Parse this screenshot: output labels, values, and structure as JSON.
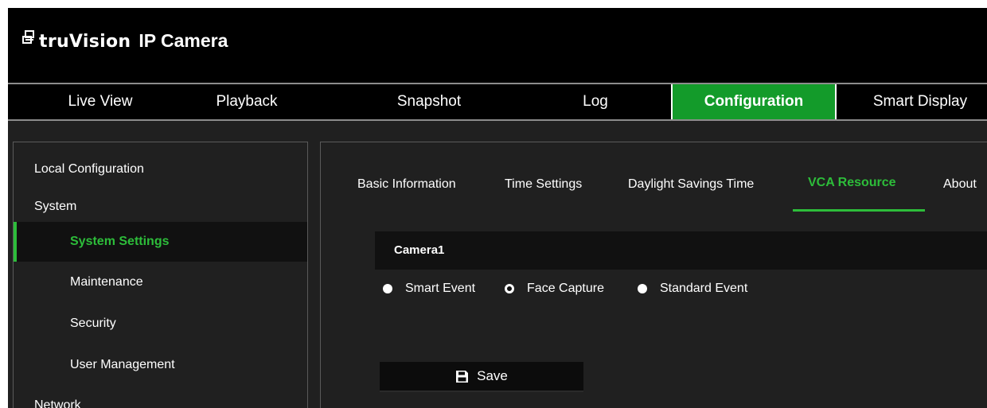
{
  "header": {
    "brand": "truVision",
    "product": "IP Camera"
  },
  "nav": {
    "items": [
      "Live View",
      "Playback",
      "Snapshot",
      "Log",
      "Configuration",
      "Smart Display"
    ],
    "active": "Configuration"
  },
  "sidebar": {
    "items": [
      {
        "label": "Local Configuration",
        "level": 1
      },
      {
        "label": "System",
        "level": 1
      },
      {
        "label": "System Settings",
        "level": 2,
        "selected": true
      },
      {
        "label": "Maintenance",
        "level": 2
      },
      {
        "label": "Security",
        "level": 2
      },
      {
        "label": "User Management",
        "level": 2
      },
      {
        "label": "Network",
        "level": 1
      }
    ]
  },
  "tabs": {
    "items": [
      "Basic Information",
      "Time Settings",
      "Daylight Savings Time",
      "VCA Resource",
      "About"
    ],
    "active": "VCA Resource"
  },
  "content": {
    "camera_label": "Camera1",
    "radio_options": [
      "Smart Event",
      "Face Capture",
      "Standard Event"
    ],
    "selected_option": "Face Capture",
    "save_label": "Save"
  },
  "colors": {
    "accent": "#139b2a",
    "accent_text": "#2dbd3a",
    "background": "#202020",
    "header": "#000000"
  },
  "icons": {
    "logo": "truvision-logo-icon",
    "save": "floppy-disk-icon"
  }
}
